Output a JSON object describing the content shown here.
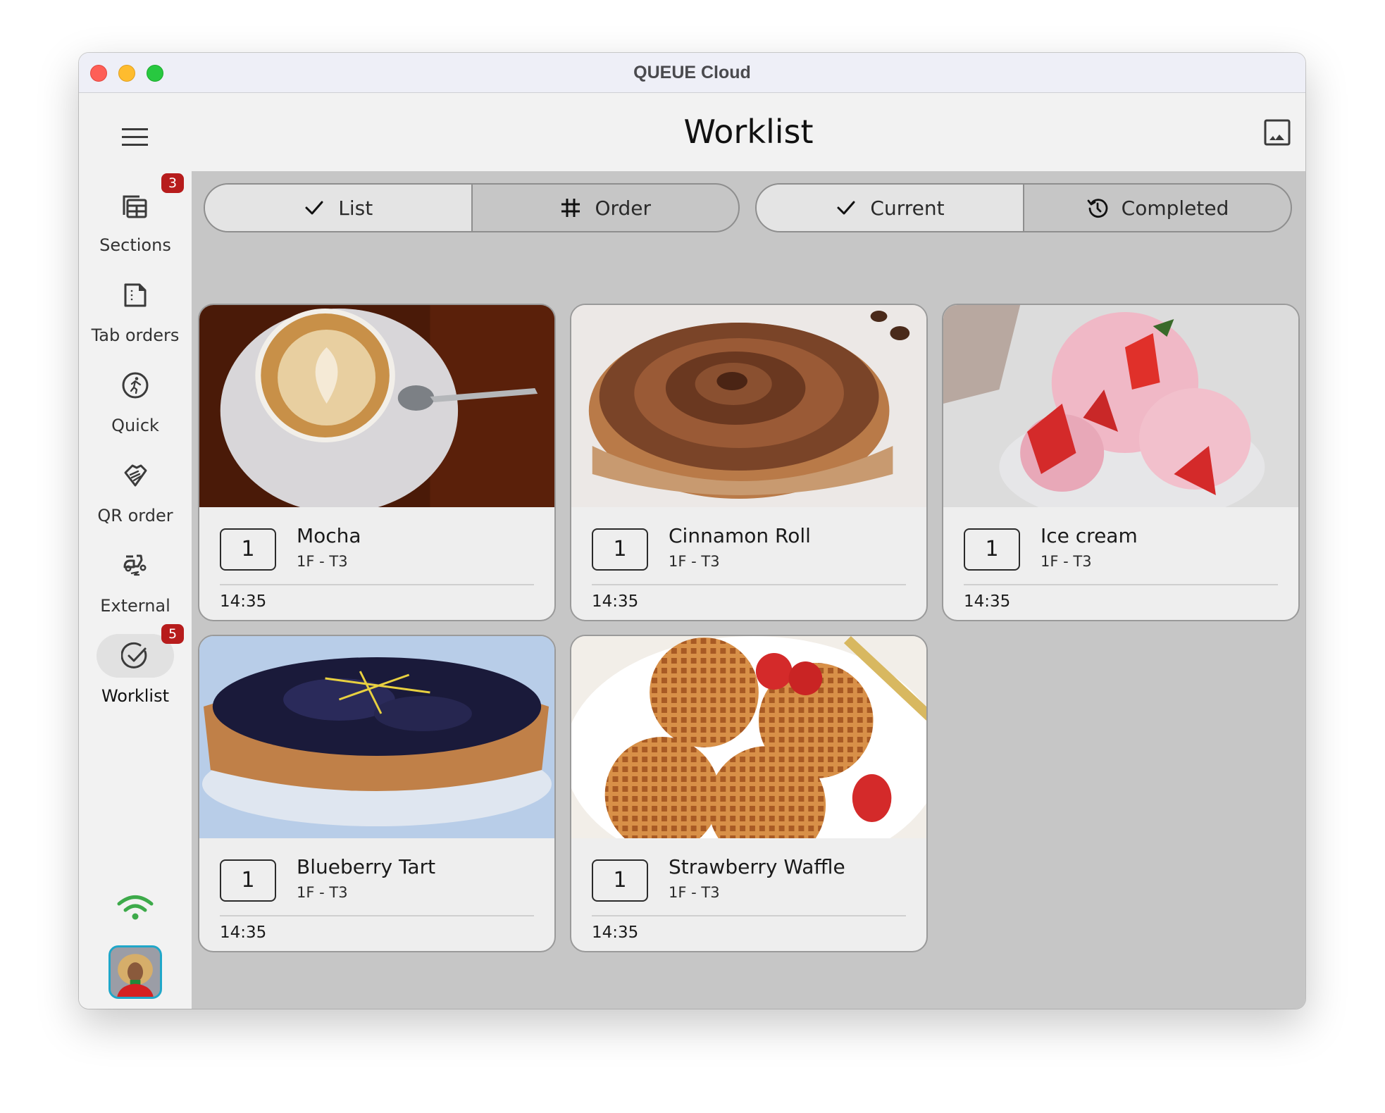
{
  "window": {
    "title": "QUEUE Cloud"
  },
  "header": {
    "title": "Worklist",
    "gallery_icon": "image-icon"
  },
  "sidebar": {
    "menu_icon": "hamburger-menu-icon",
    "items": [
      {
        "label": "Sections",
        "icon": "table-grid-icon",
        "badge": "3",
        "active": false
      },
      {
        "label": "Tab orders",
        "icon": "document-icon",
        "badge": null,
        "active": false
      },
      {
        "label": "Quick",
        "icon": "running-person-icon",
        "badge": null,
        "active": false
      },
      {
        "label": "QR order",
        "icon": "handshake-icon",
        "badge": null,
        "active": false
      },
      {
        "label": "External",
        "icon": "scooter-delivery-icon",
        "badge": null,
        "active": false
      },
      {
        "label": "Worklist",
        "icon": "check-circle-icon",
        "badge": "5",
        "active": true
      }
    ],
    "status_icon": "wifi-icon",
    "status_color": "#3daa4a",
    "avatar": "user-avatar"
  },
  "view_toggle": {
    "options": [
      {
        "label": "List",
        "icon": "check-icon",
        "selected": true
      },
      {
        "label": "Order",
        "icon": "grid-hash-icon",
        "selected": false
      }
    ]
  },
  "status_toggle": {
    "options": [
      {
        "label": "Current",
        "icon": "check-icon",
        "selected": true
      },
      {
        "label": "Completed",
        "icon": "history-icon",
        "selected": false
      }
    ]
  },
  "cards": [
    {
      "quantity": "1",
      "name": "Mocha",
      "location": "1F - T3",
      "time": "14:35",
      "image": "latte-art-coffee"
    },
    {
      "quantity": "1",
      "name": "Cinnamon Roll",
      "location": "1F - T3",
      "time": "14:35",
      "image": "cinnamon-roll"
    },
    {
      "quantity": "1",
      "name": "Ice cream",
      "location": "1F - T3",
      "time": "14:35",
      "image": "strawberry-ice-cream"
    },
    {
      "quantity": "1",
      "name": "Blueberry Tart",
      "location": "1F - T3",
      "time": "14:35",
      "image": "blueberry-tart"
    },
    {
      "quantity": "1",
      "name": "Strawberry Waffle",
      "location": "1F - T3",
      "time": "14:35",
      "image": "strawberry-waffles"
    }
  ],
  "colors": {
    "badge": "#b71c1c",
    "avatar_border": "#20a7c9",
    "content_bg": "#c6c6c6"
  }
}
